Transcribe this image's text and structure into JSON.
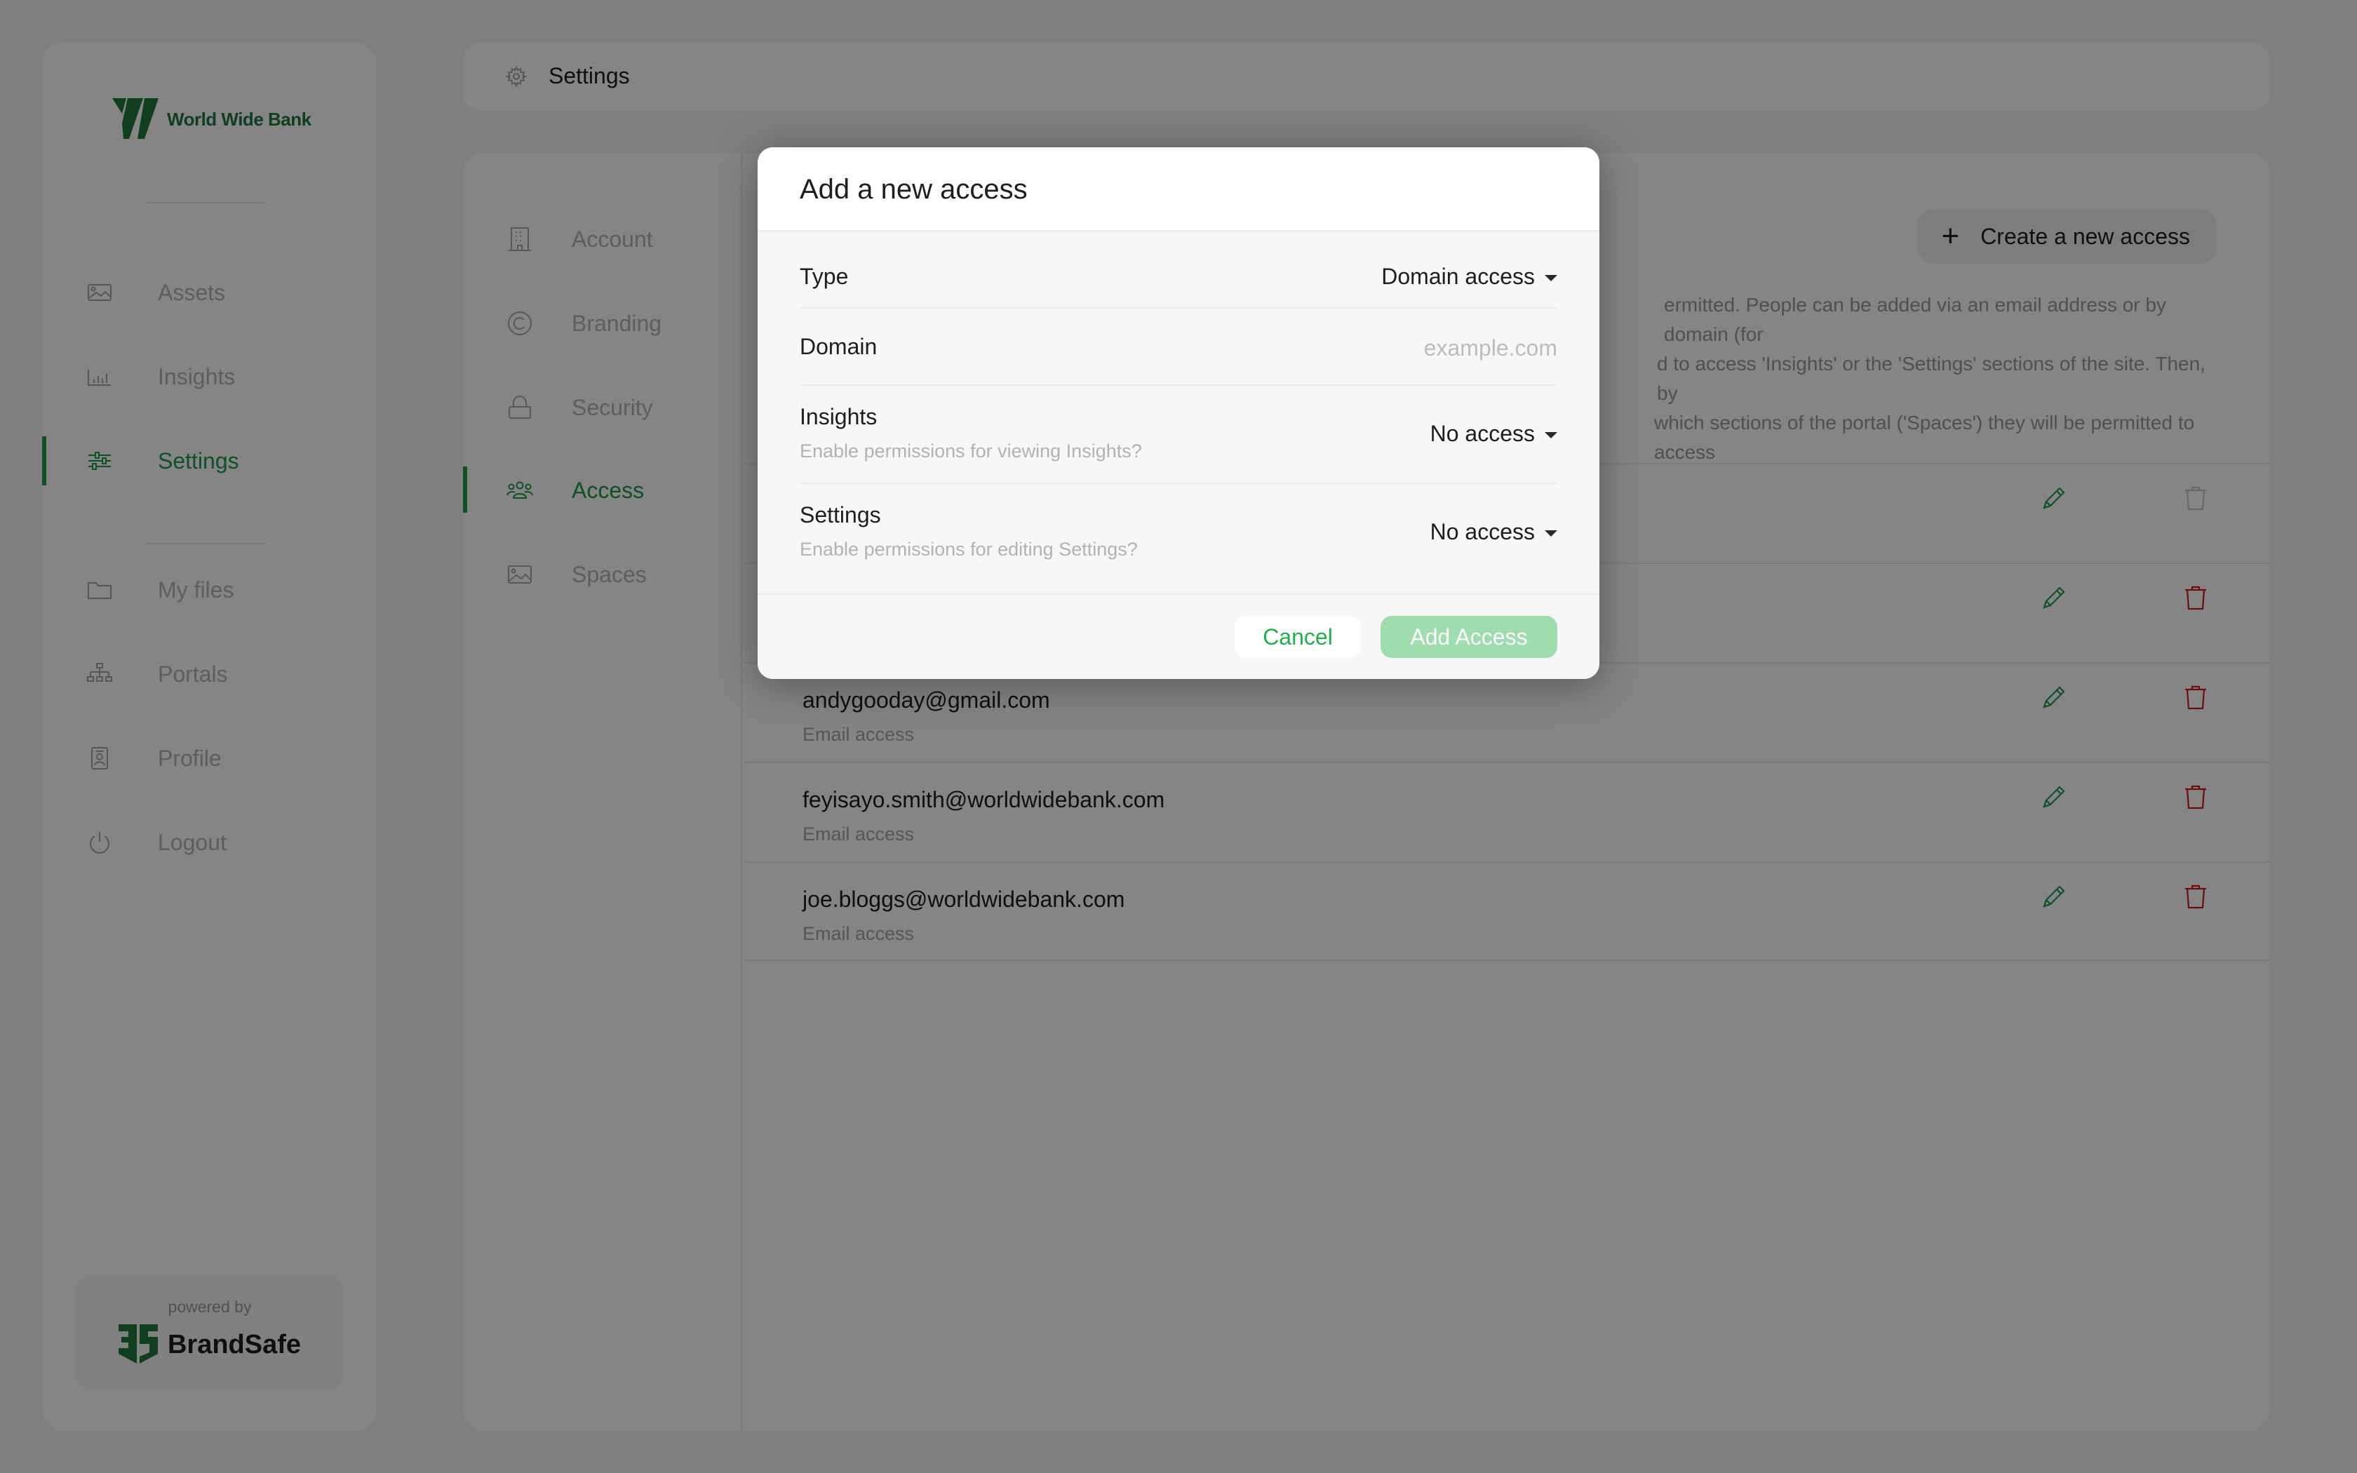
{
  "brand": {
    "name": "World Wide Bank",
    "accent": "#1e9b48",
    "danger": "#b3120f"
  },
  "sidebar": {
    "items": [
      {
        "label": "Assets",
        "icon": "image-icon",
        "active": false
      },
      {
        "label": "Insights",
        "icon": "bar-chart-icon",
        "active": false
      },
      {
        "label": "Settings",
        "icon": "sliders-icon",
        "active": true
      },
      {
        "label": "My files",
        "icon": "folder-icon",
        "active": false
      },
      {
        "label": "Portals",
        "icon": "sitemap-icon",
        "active": false
      },
      {
        "label": "Profile",
        "icon": "id-badge-icon",
        "active": false
      },
      {
        "label": "Logout",
        "icon": "power-icon",
        "active": false
      }
    ],
    "powered_by": "powered by",
    "powered_brand": "BrandSafe"
  },
  "header": {
    "title": "Settings",
    "icon": "gear-icon"
  },
  "settings_nav": {
    "items": [
      {
        "label": "Account",
        "icon": "building-icon",
        "active": false
      },
      {
        "label": "Branding",
        "icon": "copyright-icon",
        "active": false
      },
      {
        "label": "Security",
        "icon": "lock-icon",
        "active": false
      },
      {
        "label": "Access",
        "icon": "users-icon",
        "active": true
      },
      {
        "label": "Spaces",
        "icon": "image-icon",
        "active": false
      }
    ]
  },
  "access": {
    "create_button": "Create a new access",
    "description_visible": "ermitted. People can be added via an email address or by domain (for … d to access 'Insights' or the 'Settings' sections of the site. Then, by … which sections of the portal ('Spaces') they will be permitted to access",
    "description_lines": [
      "ermitted. People can be added via an email address or by domain (for",
      "d to access 'Insights' or the 'Settings' sections of the site. Then, by",
      "which sections of the portal ('Spaces') they will be permitted to access"
    ],
    "rows": [
      {
        "email": "",
        "type": "",
        "deletable": false
      },
      {
        "email": "",
        "type": "",
        "deletable": true
      },
      {
        "email": "andygooday@gmail.com",
        "type": "Email access",
        "deletable": true
      },
      {
        "email": "feyisayo.smith@worldwidebank.com",
        "type": "Email access",
        "deletable": true
      },
      {
        "email": "joe.bloggs@worldwidebank.com",
        "type": "Email access",
        "deletable": true
      }
    ]
  },
  "modal": {
    "title": "Add a new access",
    "type_label": "Type",
    "type_value": "Domain access",
    "domain_label": "Domain",
    "domain_value": "",
    "domain_placeholder": "example.com",
    "insights_label": "Insights",
    "insights_hint": "Enable permissions for viewing Insights?",
    "insights_value": "No access",
    "settings_label": "Settings",
    "settings_hint": "Enable permissions for editing Settings?",
    "settings_value": "No access",
    "cancel_label": "Cancel",
    "add_label": "Add Access",
    "add_enabled": false
  }
}
